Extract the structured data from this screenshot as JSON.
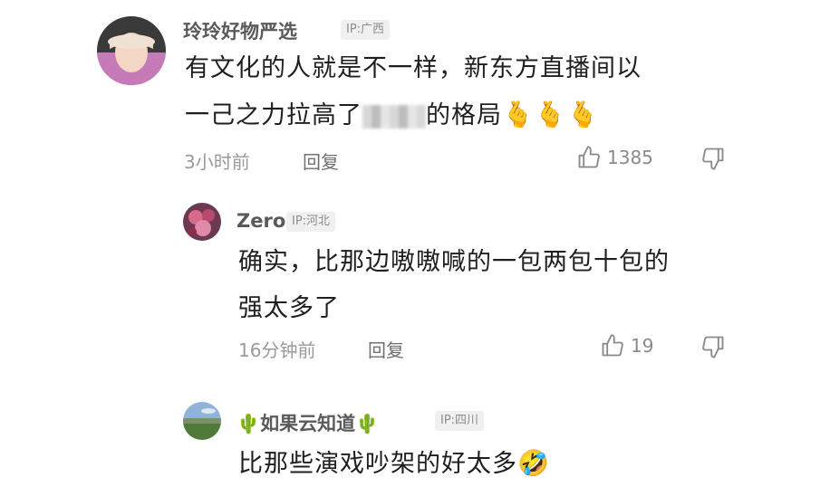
{
  "comments": [
    {
      "username": "玲玲好物严选",
      "ip": "IP:广西",
      "text_line1": "有文化的人就是不一样，新东方直播间以",
      "text_line2_before": "一己之力拉高了",
      "text_line2_after": "的格局",
      "emoji": "🫰🫰🫰",
      "time": "3小时前",
      "reply_label": "回复",
      "likes": "1385"
    },
    {
      "username": "Zero",
      "ip": "IP:河北",
      "text_line1": "确实，比那边嗷嗷喊的一包两包十包的",
      "text_line2": "强太多了",
      "time": "16分钟前",
      "reply_label": "回复",
      "likes": "19"
    },
    {
      "username": "🌵如果云知道🌵",
      "ip": "IP:四川",
      "text_line1": "比那些演戏吵架的好太多",
      "emoji": "🤣"
    }
  ],
  "icons": {
    "like": "thumbs-up-icon",
    "dislike": "thumbs-down-icon"
  },
  "colors": {
    "meta": "#9a9a9a",
    "badge_bg": "#f0f0f0",
    "text": "#1f1f1f"
  }
}
